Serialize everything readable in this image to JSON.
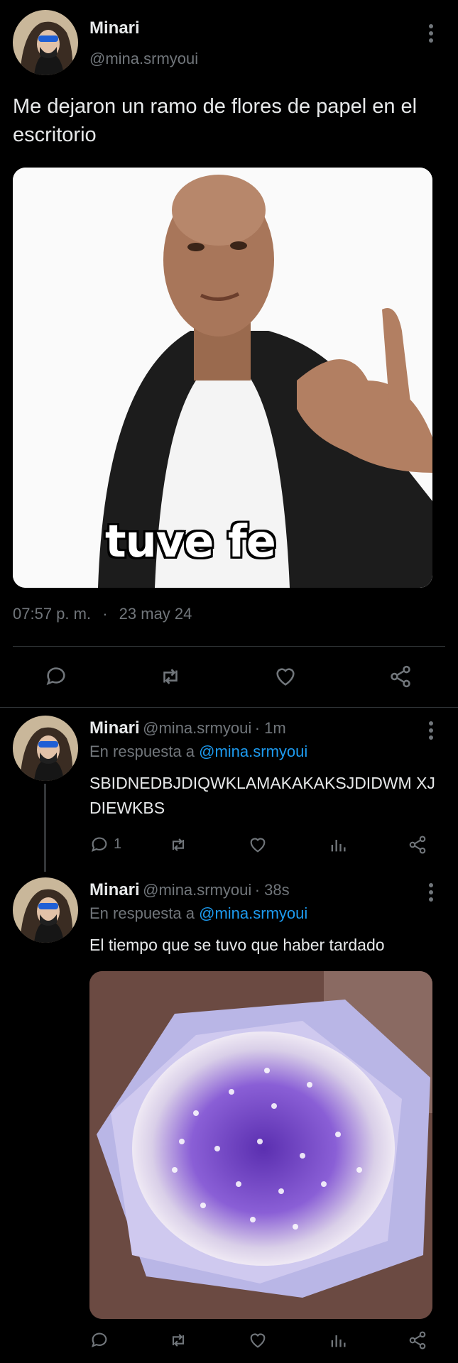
{
  "main_tweet": {
    "user_name": "Minari",
    "user_handle": "@mina.srmyoui",
    "text": "Me dejaron un ramo de flores de papel en el escritorio",
    "meme_caption": "tuve fe",
    "time": "07:57 p. m.",
    "separator": "·",
    "date": "23 may 24"
  },
  "replies": [
    {
      "user_name": "Minari",
      "user_handle": "@mina.srmyoui",
      "time_ago": "· 1m",
      "reply_prefix": "En respuesta a",
      "reply_to": "@mina.srmyoui",
      "text": "SBIDNEDBJDIQWKLAMAKAKAKSJDIDWM XJDIEWKBS",
      "reply_count": "1"
    },
    {
      "user_name": "Minari",
      "user_handle": "@mina.srmyoui",
      "time_ago": "· 38s",
      "reply_prefix": "En respuesta a",
      "reply_to": "@mina.srmyoui",
      "text": "El tiempo que se tuvo que haber tardado"
    }
  ],
  "colors": {
    "background": "#000000",
    "text": "#e7e9ea",
    "muted": "#71767b",
    "link": "#1d9bf0",
    "divider": "#2f3336",
    "flowers": "#7b4fc9"
  },
  "icons": [
    "more-vert-icon",
    "reply-icon",
    "retweet-icon",
    "like-icon",
    "share-icon",
    "analytics-icon"
  ]
}
